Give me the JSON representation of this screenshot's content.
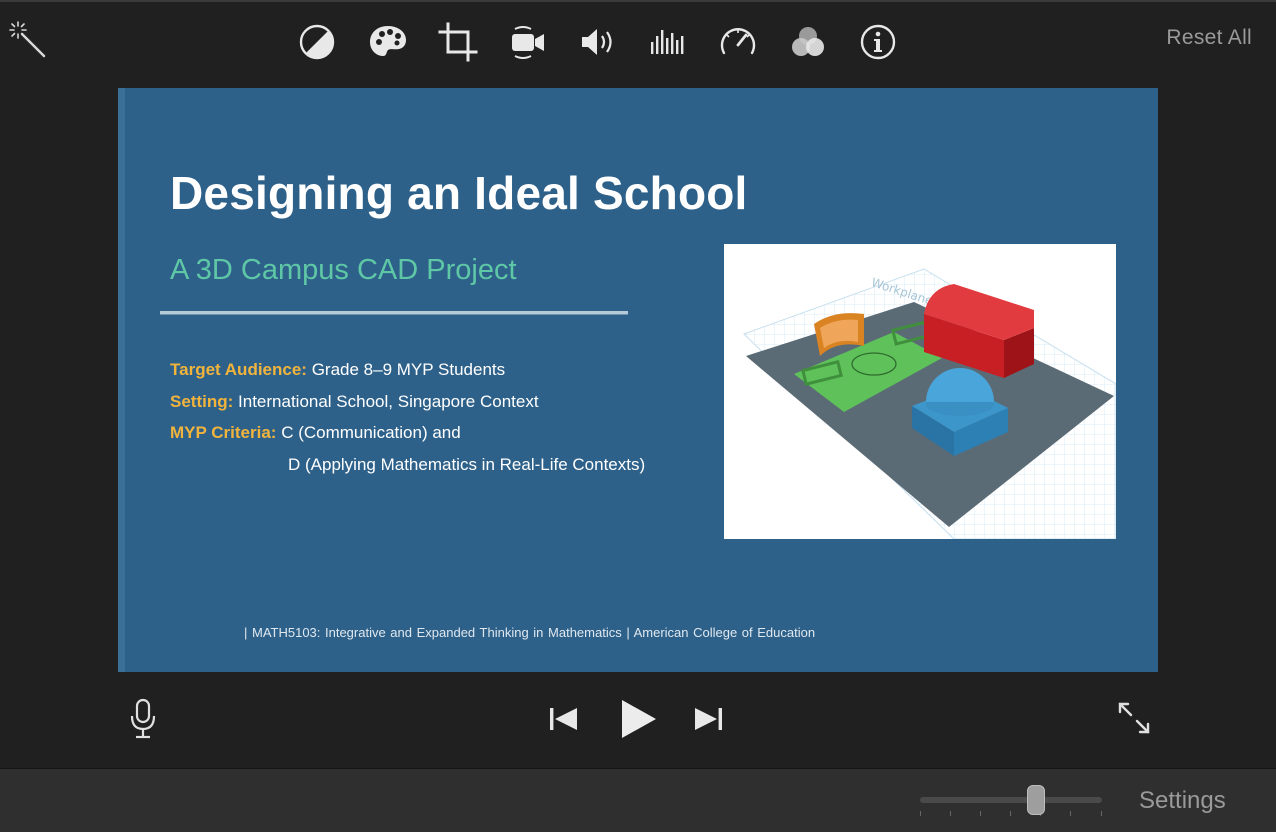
{
  "toolbar": {
    "tools": [
      {
        "icon": "color-balance-icon"
      },
      {
        "icon": "color-palette-icon"
      },
      {
        "icon": "crop-icon"
      },
      {
        "icon": "stabilization-camera-icon"
      },
      {
        "icon": "volume-icon"
      },
      {
        "icon": "equalizer-icon"
      },
      {
        "icon": "speed-gauge-icon"
      },
      {
        "icon": "clip-filter-icon"
      },
      {
        "icon": "info-icon"
      }
    ],
    "reset_all_label": "Reset All"
  },
  "slide": {
    "title": "Designing an Ideal School",
    "subtitle": "A 3D Campus CAD Project",
    "facts": [
      {
        "key": "Target Audience:",
        "value": "Grade 8–9 MYP Students"
      },
      {
        "key": "Setting:",
        "value": "International School, Singapore Context"
      },
      {
        "key": "MYP Criteria:",
        "value": "C (Communication) and"
      }
    ],
    "facts_continuation": "D (Applying Mathematics in Real-Life Contexts)",
    "footer": "|  MATH5103: Integrative and Expanded Thinking in Mathematics  |  American College of Education",
    "image_label": "Workplane"
  },
  "playback": {
    "mic_icon": "microphone-icon",
    "prev_icon": "skip-back-icon",
    "play_icon": "play-icon",
    "next_icon": "skip-forward-icon",
    "fullscreen_icon": "expand-icon"
  },
  "bottom": {
    "settings_label": "Settings",
    "zoom_level": 0.65
  },
  "colors": {
    "background": "#202020",
    "slide_bg": "#2e618a",
    "title": "#ffffff",
    "subtitle": "#5ec7a6",
    "key_accent": "#f0b43d"
  }
}
